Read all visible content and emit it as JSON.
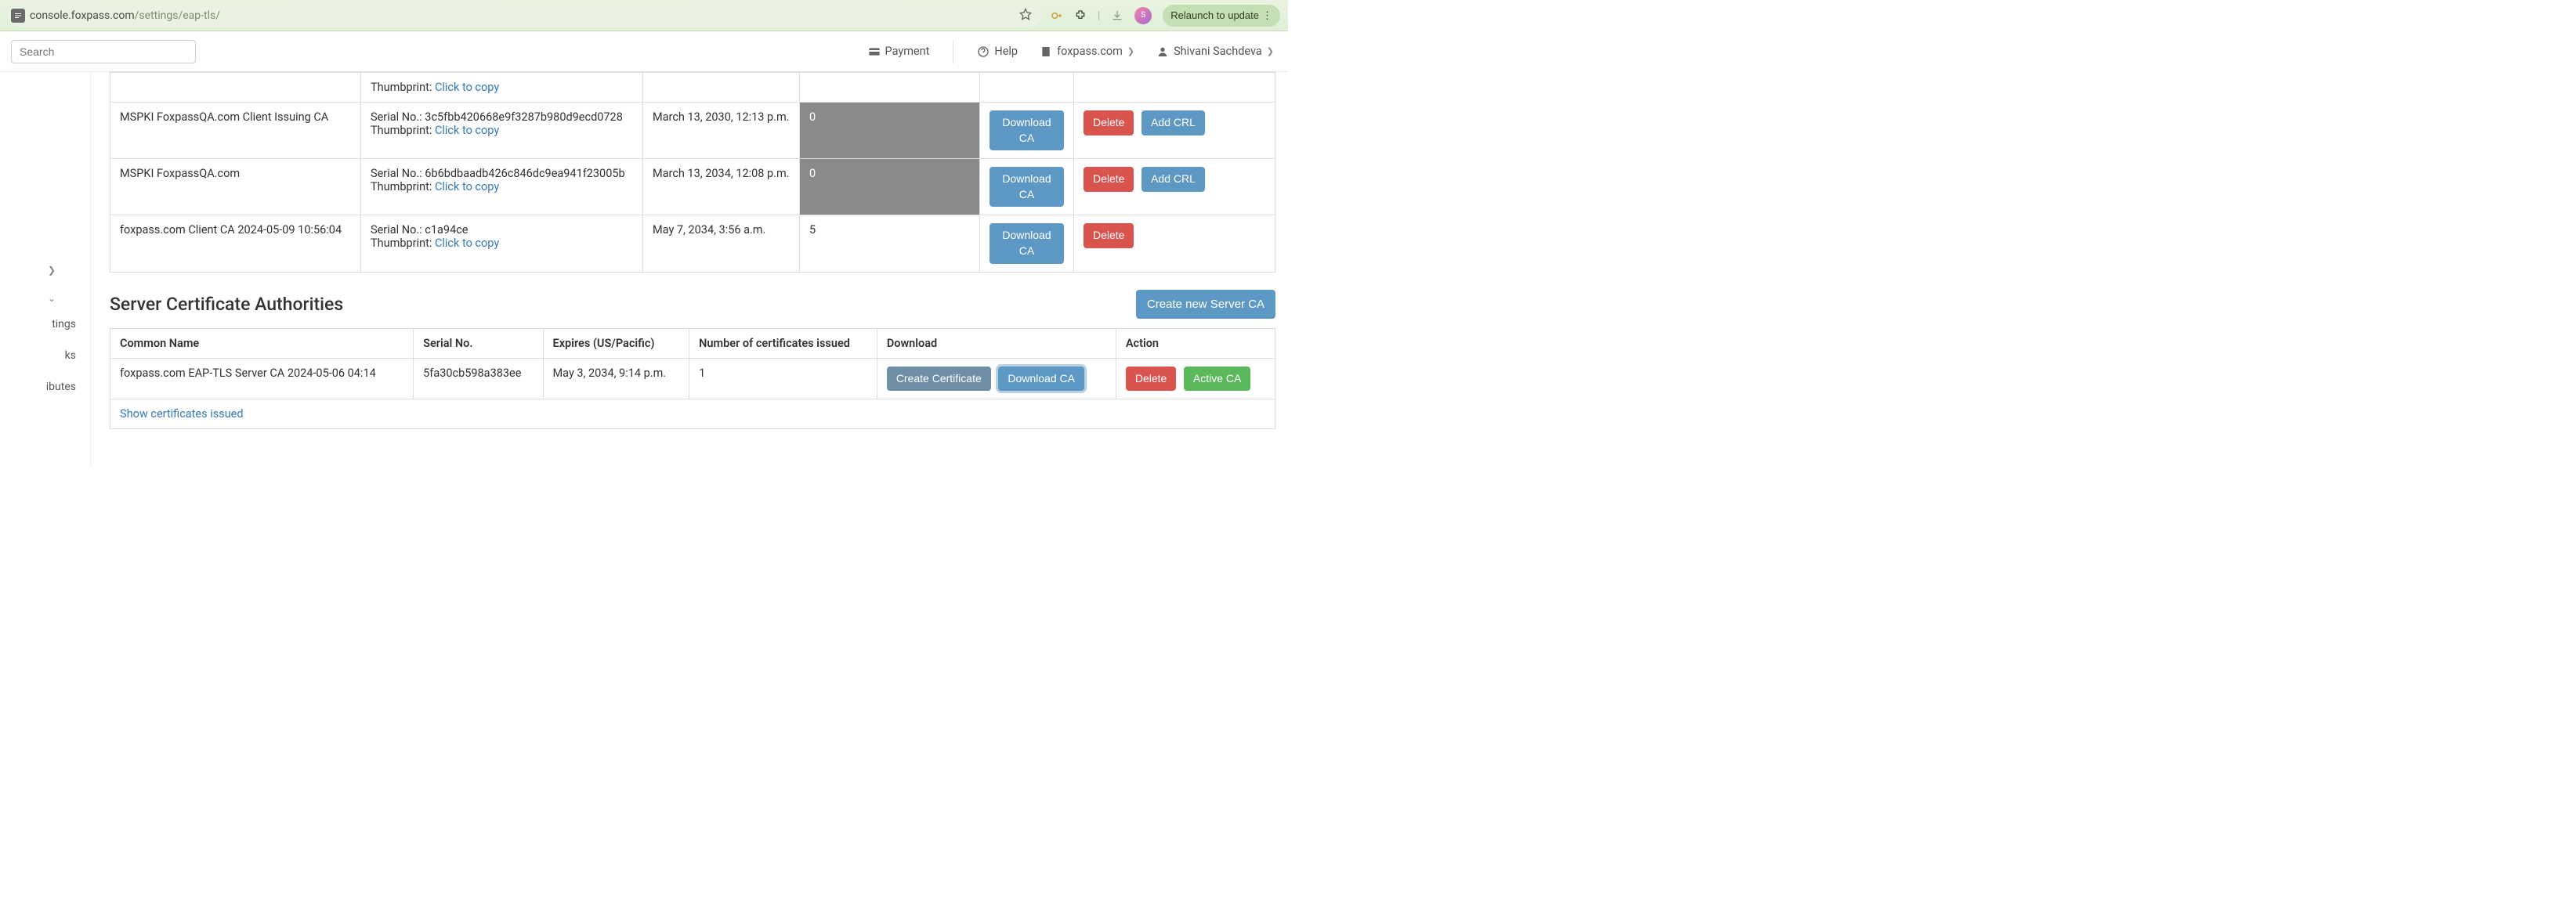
{
  "browser": {
    "url_prefix": "console.foxpass.com",
    "url_suffix": "/settings/eap-tls/",
    "relaunch_label": "Relaunch to update"
  },
  "header": {
    "search_placeholder": "Search",
    "payment": "Payment",
    "help": "Help",
    "domain": "foxpass.com",
    "user": "Shivani Sachdeva"
  },
  "sidebar": {
    "items": [
      "tings",
      "ks",
      "ibutes"
    ]
  },
  "client_ca_table": {
    "thumbprint_label": "Thumbprint: ",
    "serial_label": "Serial No.: ",
    "click_to_copy": "Click to copy",
    "rows": [
      {
        "name": "",
        "serial": "",
        "expires": "",
        "issued": "",
        "partial": true
      },
      {
        "name": "MSPKI FoxpassQA.com Client Issuing CA",
        "serial": "3c5fbb420668e9f3287b980d9ecd0728",
        "expires": "March 13, 2030, 12:13 p.m.",
        "issued": "0",
        "grey": true,
        "add_crl": true
      },
      {
        "name": "MSPKI FoxpassQA.com",
        "serial": "6b6bdbaadb426c846dc9ea941f23005b",
        "expires": "March 13, 2034, 12:08 p.m.",
        "issued": "0",
        "grey": true,
        "add_crl": true
      },
      {
        "name": "foxpass.com Client CA 2024-05-09 10:56:04",
        "serial": "c1a94ce",
        "expires": "May 7, 2034, 3:56 a.m.",
        "issued": "5",
        "grey": false,
        "add_crl": false
      }
    ],
    "buttons": {
      "download": "Download CA",
      "delete": "Delete",
      "add_crl": "Add CRL"
    }
  },
  "server_section": {
    "title": "Server Certificate Authorities",
    "create_new": "Create new Server CA",
    "headers": {
      "cn": "Common Name",
      "serial": "Serial No.",
      "expires": "Expires (US/Pacific)",
      "issued": "Number of certificates issued",
      "download": "Download",
      "action": "Action"
    },
    "row": {
      "cn": "foxpass.com EAP-TLS Server CA 2024-05-06 04:14",
      "serial": "5fa30cb598a383ee",
      "expires": "May 3, 2034, 9:14 p.m.",
      "issued": "1"
    },
    "buttons": {
      "create_cert": "Create Certificate",
      "download": "Download CA",
      "delete": "Delete",
      "active": "Active CA"
    },
    "show_link": "Show certificates issued"
  }
}
